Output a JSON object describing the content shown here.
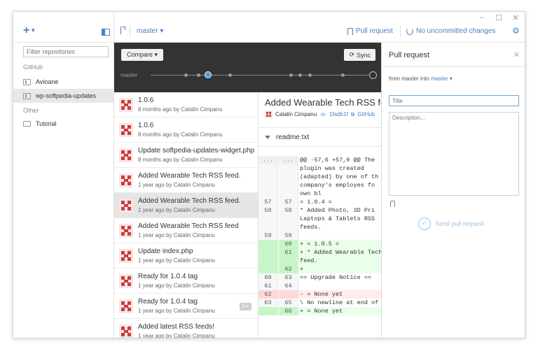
{
  "window": {
    "controls": [
      "–",
      "☐",
      "✕"
    ]
  },
  "sidebar": {
    "add_label": "+",
    "filter_placeholder": "Filter repositories",
    "sections": [
      {
        "name": "GitHub",
        "repos": [
          "Avioane",
          "wp-softpedia-updates"
        ]
      },
      {
        "name": "Other",
        "repos": [
          "Tutorial"
        ]
      }
    ],
    "selected_repo": "wp-softpedia-updates"
  },
  "toolbar": {
    "branch": "master ▾",
    "pull_request": "Pull request",
    "uncommitted": "No uncommitted changes",
    "settings_icon": "gear-icon"
  },
  "graph": {
    "compare_label": "Compare ▾",
    "sync_label": "Sync",
    "branch_label": "master"
  },
  "commits": [
    {
      "title": "1.0.6",
      "meta": "8 months ago by Catalin Cimpanu"
    },
    {
      "title": "1.0.6",
      "meta": "8 months ago by Catalin Cimpanu"
    },
    {
      "title": "Update softpedia-updates-widget.php",
      "meta": "8 months ago by Catalin Cimpanu"
    },
    {
      "title": "Added Wearable Tech RSS feed.",
      "meta": "1 year ago by Catalin Cimpanu"
    },
    {
      "title": "Added Wearable Tech RSS feed.",
      "meta": "1 year ago by Catalin Cimpanu",
      "selected": true
    },
    {
      "title": "Added Wearable Tech RSS feed",
      "meta": "1 year ago by Catalin Cimpanu"
    },
    {
      "title": "Update index.php",
      "meta": "1 year ago by Catalin Cimpanu"
    },
    {
      "title": "Ready for 1.0.4 tag",
      "meta": "1 year ago by Catalin Cimpanu"
    },
    {
      "title": "Ready for 1.0.4 tag",
      "meta": "1 year ago by Catalin Cimpanu",
      "badge": "2 ▸"
    },
    {
      "title": "Added latest RSS feeds!",
      "meta": "1 year ago by Catalin Cimpanu"
    }
  ],
  "diff": {
    "title": "Added Wearable Tech RSS feed",
    "author": "Catalin Cimpanu",
    "sha": "1fadb1f",
    "link": "GitHub",
    "file": "readme.txt",
    "lines": [
      {
        "type": "hunk",
        "n1": "...",
        "n2": "...",
        "code": "@@ -57,6 +57,9 @@ The"
      },
      {
        "type": "ctx",
        "n1": "",
        "n2": "",
        "code": "plugin was created"
      },
      {
        "type": "ctx",
        "n1": "",
        "n2": "",
        "code": "(adapted) by one of th"
      },
      {
        "type": "ctx",
        "n1": "",
        "n2": "",
        "code": "company's employes fo"
      },
      {
        "type": "ctx",
        "n1": "",
        "n2": "",
        "code": "own bl"
      },
      {
        "type": "ctx",
        "n1": "57",
        "n2": "57",
        "code": "= 1.0.4 ="
      },
      {
        "type": "ctx",
        "n1": "58",
        "n2": "58",
        "code": "* Added Photo, 3D Pri"
      },
      {
        "type": "ctx",
        "n1": "",
        "n2": "",
        "code": "Laptops & Tablets RSS"
      },
      {
        "type": "ctx",
        "n1": "",
        "n2": "",
        "code": "feeds."
      },
      {
        "type": "ctx",
        "n1": "59",
        "n2": "59",
        "code": ""
      },
      {
        "type": "add",
        "n1": "",
        "n2": "60",
        "code": "+ = 1.0.5 ="
      },
      {
        "type": "add",
        "n1": "",
        "n2": "61",
        "code": "+ * Added Wearable Tech"
      },
      {
        "type": "add",
        "n1": "",
        "n2": "",
        "code": "  feed."
      },
      {
        "type": "add",
        "n1": "",
        "n2": "62",
        "code": "+"
      },
      {
        "type": "ctx",
        "n1": "60",
        "n2": "63",
        "code": "== Upgrade Notice =="
      },
      {
        "type": "ctx",
        "n1": "61",
        "n2": "64",
        "code": ""
      },
      {
        "type": "del",
        "n1": "62",
        "n2": "",
        "code": "- = None yet"
      },
      {
        "type": "ctx",
        "n1": "63",
        "n2": "65",
        "code": "\\ No newline at end of"
      },
      {
        "type": "add",
        "n1": "",
        "n2": "66",
        "code": "+ = None yet"
      }
    ]
  },
  "pull_request": {
    "title": "Pull request",
    "from_prefix": "from",
    "from_branch": "master",
    "into": "into",
    "into_branch": "master ▾",
    "title_placeholder": "Title",
    "description_placeholder": "Description...",
    "send_label": "Send pull request"
  }
}
